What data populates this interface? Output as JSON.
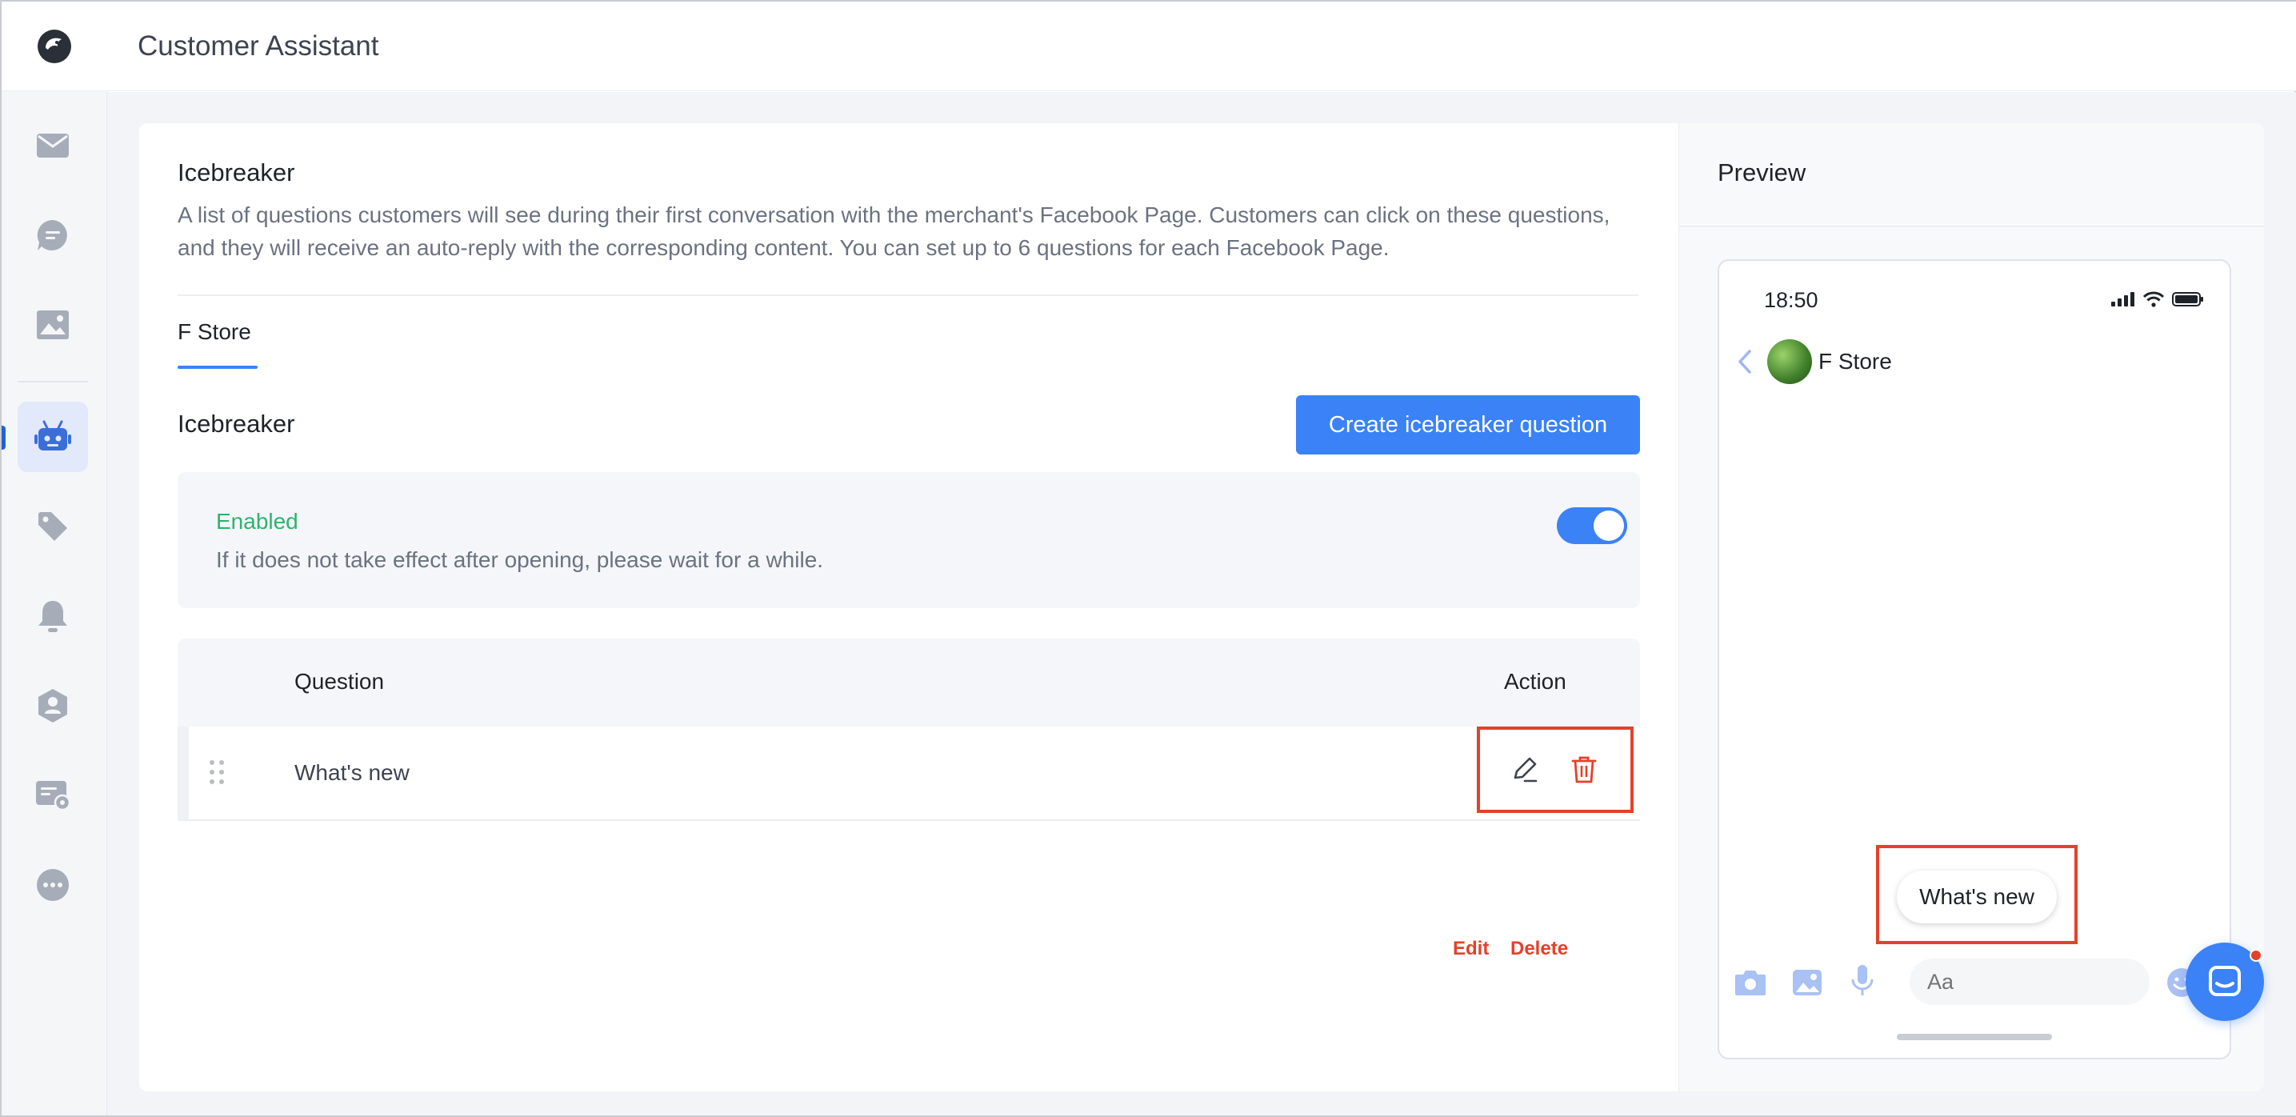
{
  "header": {
    "title": "Customer Assistant"
  },
  "sidebar": {
    "items": [
      {
        "icon": "mail-icon"
      },
      {
        "icon": "chat-bubble-icon"
      },
      {
        "icon": "image-icon"
      },
      {
        "icon": "robot-icon",
        "active": true
      },
      {
        "icon": "tag-icon"
      },
      {
        "icon": "bell-icon"
      },
      {
        "icon": "user-shield-icon"
      },
      {
        "icon": "card-settings-icon"
      },
      {
        "icon": "more-icon"
      }
    ]
  },
  "main": {
    "title": "Icebreaker",
    "description": "A list of questions customers will see during their first conversation with the merchant's Facebook Page. Customers can click on these questions, and they will receive an auto-reply with the corresponding content. You can set up to 6 questions for each Facebook Page.",
    "tabs": [
      {
        "label": "F Store",
        "active": true
      }
    ],
    "section_title": "Icebreaker",
    "create_button": "Create icebreaker question",
    "status": {
      "label": "Enabled",
      "hint": "If it does not take effect after opening, please wait for a while.",
      "enabled": true
    },
    "table": {
      "columns": {
        "question": "Question",
        "action": "Action"
      },
      "rows": [
        {
          "question": "What's new"
        }
      ]
    },
    "annotations": {
      "edit": "Edit",
      "delete": "Delete"
    }
  },
  "preview": {
    "title": "Preview",
    "phone": {
      "time": "18:50",
      "chat_name": "F Store",
      "icebreaker": "What's new",
      "input_placeholder": "Aa"
    }
  },
  "colors": {
    "accent": "#3b82f6",
    "enabled": "#2fb36f",
    "annotation": "#e5402b"
  }
}
